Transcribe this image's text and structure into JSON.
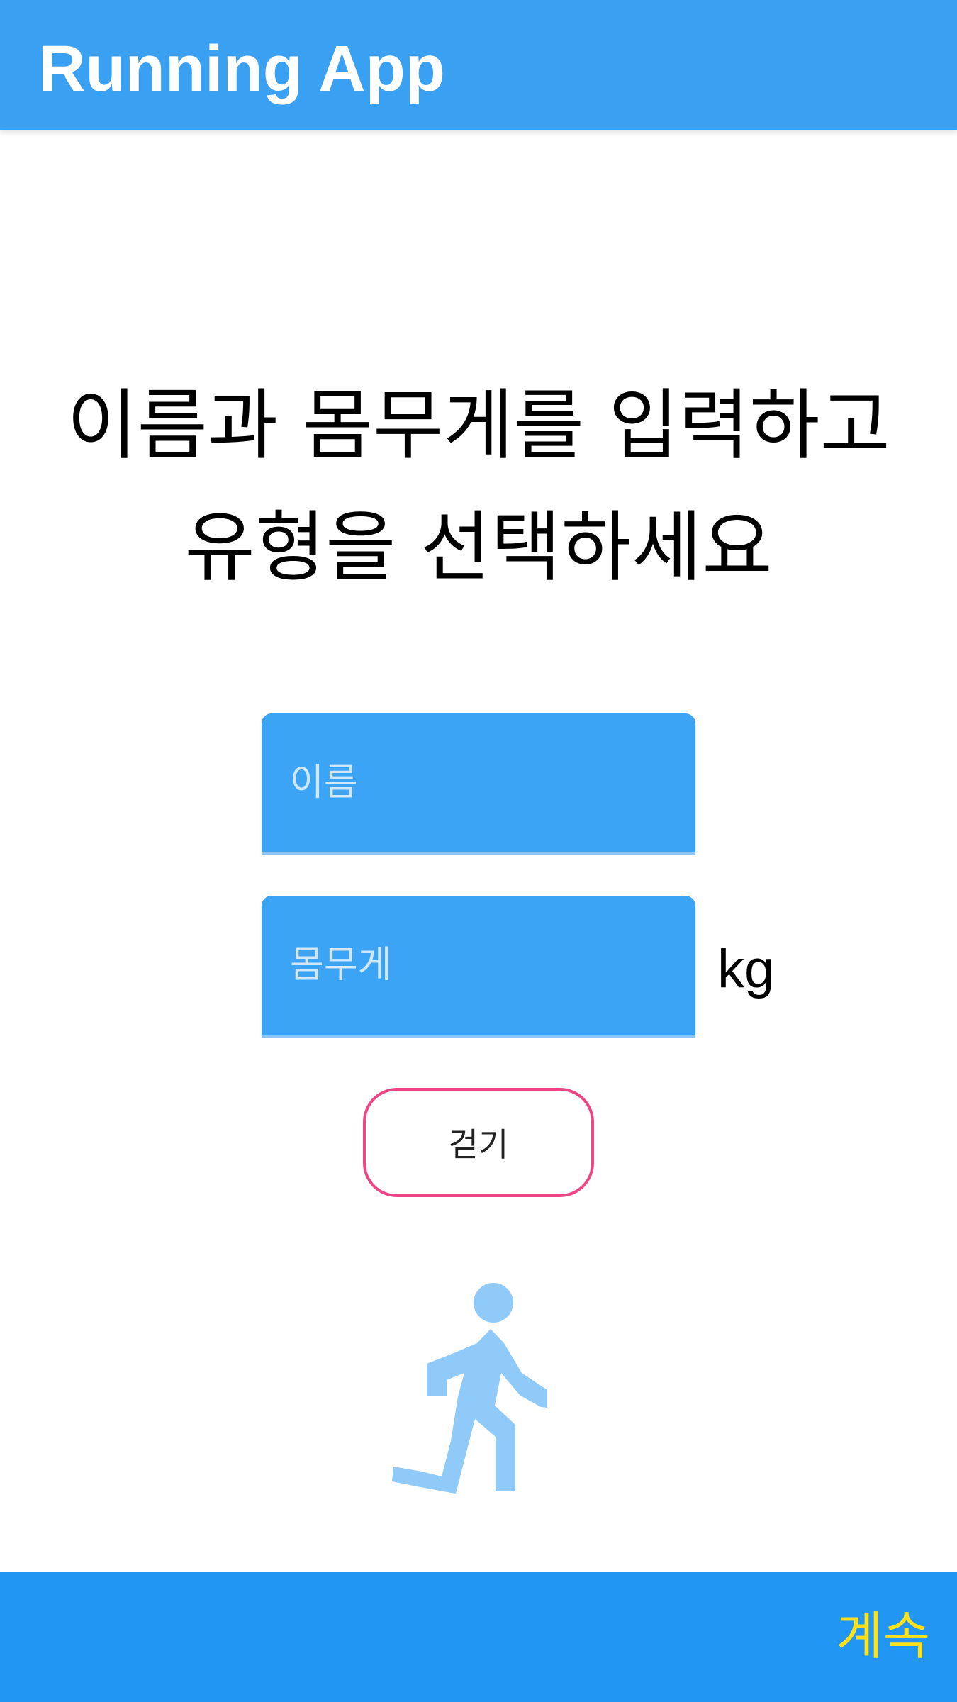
{
  "app_bar": {
    "title": "Running App"
  },
  "instruction": {
    "line1": "이름과 몸무게를 입력하고",
    "line2": "유형을 선택하세요"
  },
  "form": {
    "name_placeholder": "이름",
    "name_value": "",
    "weight_placeholder": "몸무게",
    "weight_value": "",
    "weight_unit": "kg"
  },
  "type_selector": {
    "label": "걷기",
    "icon": "running-person-icon"
  },
  "bottom_bar": {
    "continue_label": "계속"
  },
  "colors": {
    "app_bar": "#3aa0f2",
    "input_fill": "#3ca4f4",
    "button_border": "#ee4585",
    "icon": "#90caf9",
    "bottom_bar": "#2196f3",
    "continue_text": "#ffe11a"
  }
}
